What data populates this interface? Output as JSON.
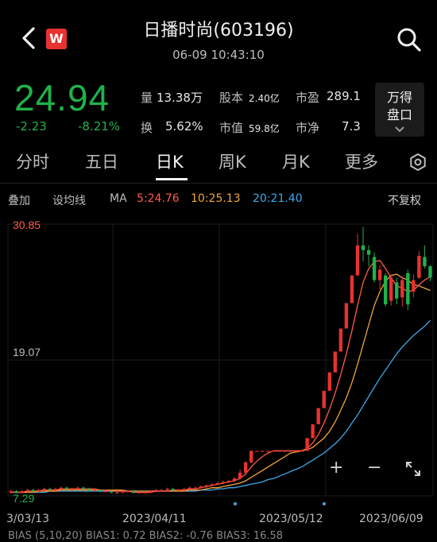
{
  "header": {
    "title": "日播时尚(603196)",
    "time": "06-09 10:43:10",
    "logo_text": "W"
  },
  "quote": {
    "price": "24.94",
    "change": "-2.23",
    "change_pct": "-8.21%",
    "stats": [
      {
        "label": "量",
        "value": "13.38万"
      },
      {
        "label": "股本",
        "value": "2.40亿"
      },
      {
        "label": "市盈",
        "value": "289.1"
      },
      {
        "label": "换",
        "value": "5.62%"
      },
      {
        "label": "市值",
        "value": "59.8亿"
      },
      {
        "label": "市净",
        "value": "7.3"
      }
    ],
    "wande_label": "万得盘口",
    "colors": {
      "down": "#1fb24a",
      "up": "#e8322f"
    }
  },
  "tabs": {
    "items": [
      "分时",
      "五日",
      "日K",
      "周K",
      "月K",
      "更多"
    ],
    "active": "日K"
  },
  "ma_row": {
    "overlay": "叠加",
    "setting": "设均线",
    "label": "MA",
    "ma5": "5:24.76",
    "ma10": "10:25.13",
    "ma20": "20:21.40",
    "adjust": "不复权"
  },
  "chart_data": {
    "type": "candlestick",
    "y_max_label": "30.85",
    "y_mid_label": "19.07",
    "y_min_label": "7.29",
    "ylim": [
      7.29,
      30.85
    ],
    "x_labels": [
      "3/03/13",
      "2023/04/11",
      "2023/05/12",
      "2023/06/09"
    ],
    "ma_colors": {
      "ma5": "#ff5b4a",
      "ma10": "#f2a43a",
      "ma20": "#3fa8e8"
    },
    "candles": [
      [
        7.6,
        7.7,
        7.5,
        7.8
      ],
      [
        7.7,
        7.6,
        7.5,
        7.8
      ],
      [
        7.6,
        7.7,
        7.5,
        7.8
      ],
      [
        7.7,
        7.8,
        7.6,
        7.9
      ],
      [
        7.8,
        7.7,
        7.6,
        7.9
      ],
      [
        7.7,
        7.8,
        7.6,
        7.9
      ],
      [
        7.8,
        7.9,
        7.7,
        8.0
      ],
      [
        7.9,
        7.8,
        7.7,
        8.0
      ],
      [
        7.8,
        7.9,
        7.7,
        8.0
      ],
      [
        7.9,
        8.0,
        7.8,
        8.1
      ],
      [
        8.0,
        7.9,
        7.8,
        8.1
      ],
      [
        7.9,
        7.9,
        7.8,
        8.0
      ],
      [
        7.9,
        8.0,
        7.8,
        8.1
      ],
      [
        8.0,
        7.9,
        7.8,
        8.1
      ],
      [
        7.9,
        7.8,
        7.7,
        8.0
      ],
      [
        7.8,
        7.8,
        7.7,
        7.9
      ],
      [
        7.8,
        7.7,
        7.6,
        7.9
      ],
      [
        7.7,
        7.7,
        7.6,
        7.8
      ],
      [
        7.7,
        7.6,
        7.5,
        7.8
      ],
      [
        7.6,
        7.6,
        7.5,
        7.7
      ],
      [
        7.6,
        7.7,
        7.5,
        7.8
      ],
      [
        7.7,
        7.7,
        7.6,
        7.8
      ],
      [
        7.7,
        7.6,
        7.5,
        7.8
      ],
      [
        7.6,
        7.6,
        7.5,
        7.7
      ],
      [
        7.6,
        7.6,
        7.5,
        7.7
      ],
      [
        7.6,
        7.7,
        7.5,
        7.8
      ],
      [
        7.7,
        7.8,
        7.6,
        7.9
      ],
      [
        7.8,
        7.8,
        7.7,
        7.9
      ],
      [
        7.8,
        7.9,
        7.7,
        8.0
      ],
      [
        7.9,
        7.8,
        7.7,
        8.0
      ],
      [
        7.8,
        7.8,
        7.7,
        7.9
      ],
      [
        7.8,
        7.9,
        7.7,
        8.0
      ],
      [
        7.9,
        8.0,
        7.8,
        8.1
      ],
      [
        8.0,
        8.0,
        7.9,
        8.1
      ],
      [
        8.0,
        8.1,
        7.9,
        8.2
      ],
      [
        8.1,
        8.2,
        8.0,
        8.3
      ],
      [
        8.2,
        8.3,
        8.1,
        8.4
      ],
      [
        8.3,
        8.4,
        8.2,
        8.5
      ],
      [
        8.4,
        8.5,
        8.3,
        8.6
      ],
      [
        8.5,
        8.6,
        8.4,
        8.7
      ],
      [
        8.6,
        8.8,
        8.5,
        8.9
      ],
      [
        8.8,
        9.3,
        8.7,
        9.6
      ],
      [
        9.3,
        10.2,
        9.2,
        10.3
      ],
      [
        10.2,
        11.2,
        10.1,
        11.2
      ],
      [
        11.2,
        11.2,
        11.2,
        11.2
      ],
      [
        11.2,
        11.2,
        11.2,
        11.2
      ],
      [
        11.2,
        11.2,
        11.2,
        11.2
      ],
      [
        11.2,
        11.2,
        11.2,
        11.2
      ],
      [
        11.2,
        11.2,
        11.2,
        11.2
      ],
      [
        11.2,
        11.2,
        11.2,
        11.2
      ],
      [
        11.2,
        11.2,
        11.2,
        11.2
      ],
      [
        11.2,
        11.2,
        11.2,
        11.2
      ],
      [
        11.2,
        11.2,
        11.2,
        11.2
      ],
      [
        11.2,
        12.3,
        11.2,
        12.3
      ],
      [
        12.3,
        13.5,
        12.3,
        13.5
      ],
      [
        13.5,
        14.9,
        13.5,
        14.9
      ],
      [
        14.9,
        16.4,
        14.9,
        16.4
      ],
      [
        16.4,
        18.0,
        16.4,
        18.0
      ],
      [
        18.0,
        19.8,
        18.0,
        19.8
      ],
      [
        19.8,
        21.8,
        19.8,
        21.8
      ],
      [
        21.8,
        24.0,
        21.8,
        24.0
      ],
      [
        24.0,
        26.4,
        24.0,
        26.4
      ],
      [
        26.4,
        29.0,
        26.4,
        30.0
      ],
      [
        29.0,
        28.6,
        27.6,
        30.6
      ],
      [
        28.6,
        28.2,
        27.2,
        29.0
      ],
      [
        28.0,
        26.0,
        25.8,
        28.4
      ],
      [
        26.0,
        26.9,
        25.2,
        27.3
      ],
      [
        26.4,
        23.9,
        23.7,
        26.6
      ],
      [
        24.2,
        26.2,
        23.8,
        26.5
      ],
      [
        25.8,
        24.4,
        23.9,
        26.2
      ],
      [
        24.5,
        26.0,
        23.7,
        26.3
      ],
      [
        26.6,
        23.9,
        23.4,
        26.9
      ],
      [
        25.0,
        26.0,
        24.5,
        26.5
      ],
      [
        26.2,
        28.1,
        26.1,
        28.5
      ],
      [
        28.0,
        27.2,
        27.0,
        29.0
      ],
      [
        27.2,
        26.2,
        25.9,
        27.3
      ]
    ],
    "ma5_values": [
      7.6,
      7.6,
      7.6,
      7.7,
      7.7,
      7.7,
      7.8,
      7.8,
      7.8,
      7.9,
      7.9,
      7.9,
      7.9,
      7.9,
      7.9,
      7.9,
      7.8,
      7.8,
      7.7,
      7.7,
      7.7,
      7.7,
      7.6,
      7.6,
      7.6,
      7.6,
      7.7,
      7.7,
      7.7,
      7.8,
      7.8,
      7.8,
      7.9,
      7.9,
      8.0,
      8.1,
      8.2,
      8.3,
      8.4,
      8.5,
      8.6,
      8.8,
      9.2,
      9.8,
      10.3,
      10.7,
      11.0,
      11.2,
      11.2,
      11.2,
      11.2,
      11.2,
      11.2,
      11.4,
      11.9,
      12.6,
      13.6,
      14.8,
      16.2,
      17.8,
      19.6,
      21.6,
      23.8,
      25.8,
      27.0,
      27.6,
      27.7,
      27.0,
      26.2,
      25.5,
      25.3,
      25.0,
      25.1,
      25.6,
      26.0,
      26.3
    ],
    "ma10_values": [
      7.6,
      7.6,
      7.6,
      7.6,
      7.6,
      7.7,
      7.7,
      7.7,
      7.7,
      7.8,
      7.8,
      7.8,
      7.8,
      7.8,
      7.8,
      7.8,
      7.8,
      7.8,
      7.8,
      7.8,
      7.8,
      7.7,
      7.7,
      7.7,
      7.7,
      7.7,
      7.7,
      7.7,
      7.7,
      7.7,
      7.7,
      7.7,
      7.8,
      7.8,
      7.8,
      7.9,
      8.0,
      8.0,
      8.1,
      8.2,
      8.3,
      8.4,
      8.6,
      8.9,
      9.2,
      9.5,
      9.8,
      10.1,
      10.4,
      10.7,
      11.0,
      11.1,
      11.2,
      11.3,
      11.5,
      11.9,
      12.3,
      12.9,
      13.7,
      14.7,
      15.8,
      17.1,
      18.7,
      20.4,
      22.1,
      23.8,
      25.0,
      25.9,
      26.4,
      26.5,
      26.2,
      26.0,
      25.6,
      25.5,
      25.3,
      25.1
    ],
    "ma20_values": [
      7.6,
      7.6,
      7.6,
      7.6,
      7.6,
      7.6,
      7.6,
      7.7,
      7.7,
      7.7,
      7.7,
      7.7,
      7.7,
      7.7,
      7.7,
      7.7,
      7.7,
      7.7,
      7.7,
      7.7,
      7.7,
      7.7,
      7.7,
      7.7,
      7.7,
      7.7,
      7.7,
      7.7,
      7.7,
      7.7,
      7.7,
      7.7,
      7.7,
      7.7,
      7.8,
      7.8,
      7.8,
      7.9,
      7.9,
      8.0,
      8.0,
      8.1,
      8.2,
      8.3,
      8.4,
      8.5,
      8.7,
      8.8,
      9.0,
      9.2,
      9.4,
      9.6,
      9.8,
      10.1,
      10.4,
      10.7,
      11.0,
      11.4,
      11.8,
      12.3,
      12.9,
      13.6,
      14.3,
      15.1,
      15.9,
      16.7,
      17.5,
      18.2,
      18.9,
      19.6,
      20.2,
      20.7,
      21.2,
      21.6,
      22.0,
      22.5
    ]
  },
  "zoom": {
    "plus": "+",
    "minus": "−"
  },
  "bias_row": "BIAS (5,10,20)  BIAS1: 0.72  BIAS2: -0.76  BIAS3: 16.58"
}
